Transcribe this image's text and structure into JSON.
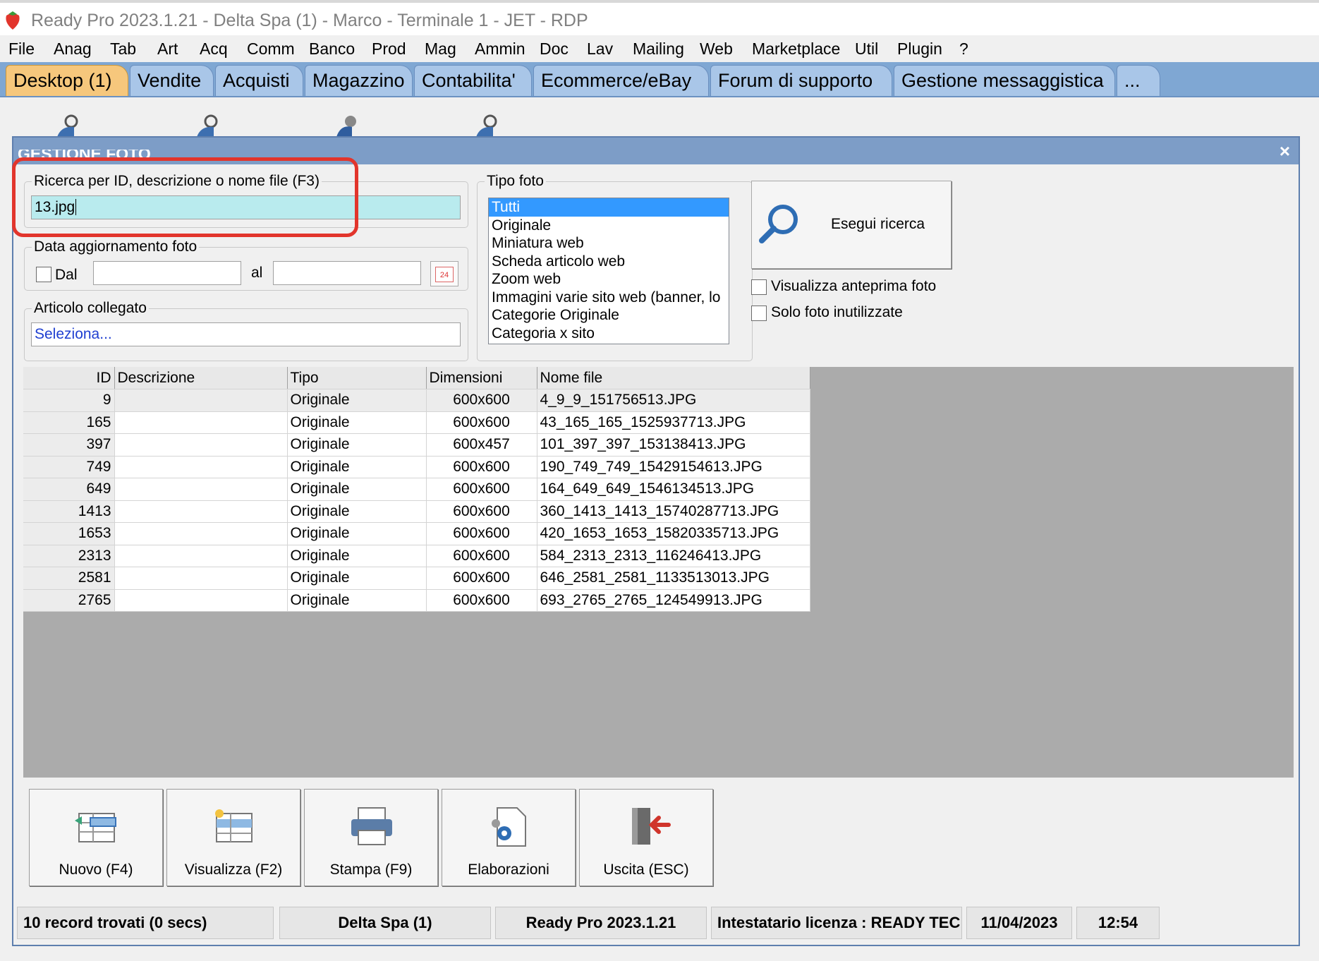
{
  "window": {
    "title": "Ready Pro 2023.1.21 - Delta Spa (1) - Marco - Terminale 1 - JET - RDP"
  },
  "menu": [
    "File",
    "Anag",
    "Tab",
    "Art",
    "Acq",
    "Comm",
    "Banco",
    "Prod",
    "Mag",
    "Ammin",
    "Doc",
    "Lav",
    "Mailing",
    "Web",
    "Marketplace",
    "Util",
    "Plugin",
    "?"
  ],
  "tabs": [
    "Desktop (1)",
    "Vendite",
    "Acquisti",
    "Magazzino",
    "Contabilita'",
    "Ecommerce/eBay",
    "Forum di supporto",
    "Gestione messaggistica",
    "..."
  ],
  "dialog": {
    "title": "GESTIONE FOTO",
    "close": "×",
    "search": {
      "label": "Ricerca per ID, descrizione o nome file (F3)",
      "value": "13.jpg"
    },
    "date_filter": {
      "label": "Data aggiornamento foto",
      "from_label": "Dal",
      "to_label": "al",
      "from_value": "",
      "to_value": "",
      "calendar_text": "24"
    },
    "article": {
      "label": "Articolo collegato",
      "value": "Seleziona..."
    },
    "photo_type": {
      "label": "Tipo foto",
      "options": [
        "Tutti",
        "Originale",
        "Miniatura web",
        "Scheda articolo web",
        "Zoom web",
        "Immagini varie sito web (banner, lo",
        "Categorie Originale",
        "Categoria x sito"
      ],
      "selected": "Tutti"
    },
    "search_button": "Esegui ricerca",
    "preview_checkbox": "Visualizza anteprima foto",
    "unused_checkbox": "Solo foto inutilizzate",
    "grid": {
      "columns": [
        "ID",
        "Descrizione",
        "Tipo",
        "Dimensioni",
        "Nome file"
      ],
      "rows": [
        {
          "id": "9",
          "desc": "",
          "tipo": "Originale",
          "dim": "600x600",
          "file": "4_9_9_151756513.JPG"
        },
        {
          "id": "165",
          "desc": "",
          "tipo": "Originale",
          "dim": "600x600",
          "file": "43_165_165_1525937713.JPG"
        },
        {
          "id": "397",
          "desc": "",
          "tipo": "Originale",
          "dim": "600x457",
          "file": "101_397_397_153138413.JPG"
        },
        {
          "id": "749",
          "desc": "",
          "tipo": "Originale",
          "dim": "600x600",
          "file": "190_749_749_15429154613.JPG"
        },
        {
          "id": "649",
          "desc": "",
          "tipo": "Originale",
          "dim": "600x600",
          "file": "164_649_649_1546134513.JPG"
        },
        {
          "id": "1413",
          "desc": "",
          "tipo": "Originale",
          "dim": "600x600",
          "file": "360_1413_1413_15740287713.JPG"
        },
        {
          "id": "1653",
          "desc": "",
          "tipo": "Originale",
          "dim": "600x600",
          "file": "420_1653_1653_15820335713.JPG"
        },
        {
          "id": "2313",
          "desc": "",
          "tipo": "Originale",
          "dim": "600x600",
          "file": "584_2313_2313_116246413.JPG"
        },
        {
          "id": "2581",
          "desc": "",
          "tipo": "Originale",
          "dim": "600x600",
          "file": "646_2581_2581_1133513013.JPG"
        },
        {
          "id": "2765",
          "desc": "",
          "tipo": "Originale",
          "dim": "600x600",
          "file": "693_2765_2765_124549913.JPG"
        }
      ]
    },
    "buttons": {
      "new": "Nuovo (F4)",
      "view": "Visualizza (F2)",
      "print": "Stampa (F9)",
      "process": "Elaborazioni",
      "exit": "Uscita (ESC)"
    },
    "status": {
      "records": "10 record trovati (0 secs)",
      "company": "Delta Spa (1)",
      "version": "Ready Pro 2023.1.21",
      "license": "Intestatario licenza : READY TEC",
      "date": "11/04/2023",
      "time": "12:54"
    }
  },
  "colors": {
    "tab_bar": "#7fa7d3",
    "active_tab": "#f6c77c",
    "dialog_header": "#7d9dc7",
    "search_field": "#b9ebee",
    "highlight": "#e2352c",
    "list_selection": "#3399ff",
    "grid_background": "#ababab"
  }
}
